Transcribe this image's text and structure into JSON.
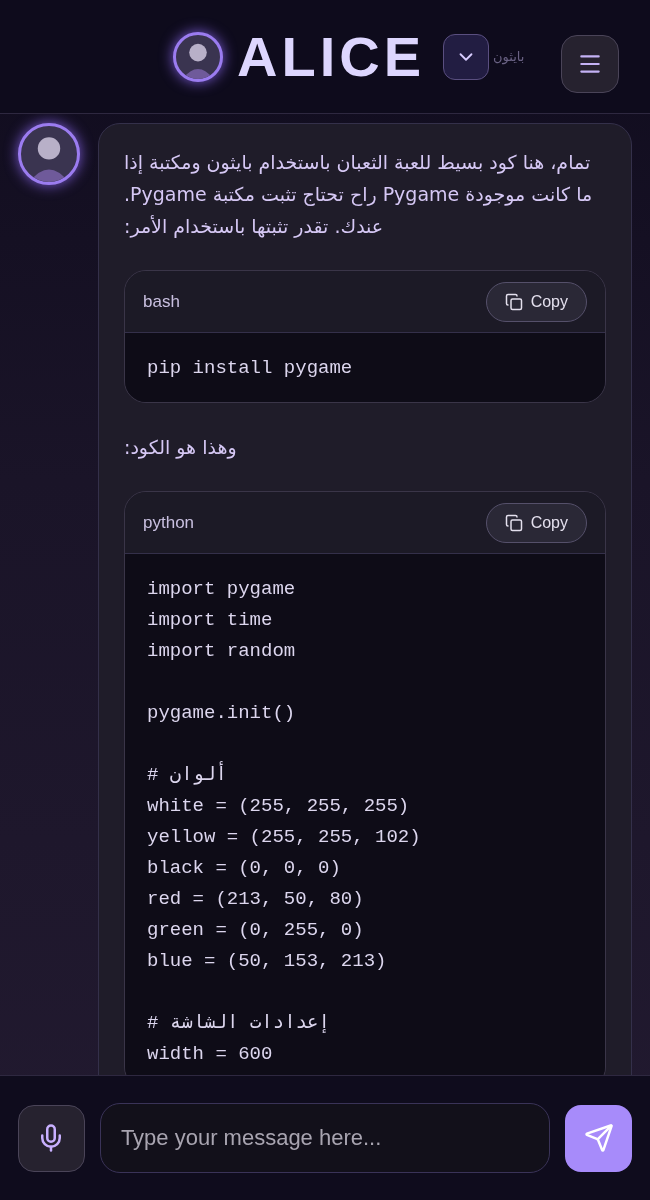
{
  "header": {
    "title": "ALICE",
    "hidden_label": "بايثون"
  },
  "messages": [
    {
      "parts": [
        {
          "kind": "text",
          "text": "تمام، هنا كود بسيط للعبة الثعبان باستخدام بايثون ومكتبة إذا ما كانت موجودة Pygame راح تحتاج تثبت مكتبة Pygame. عندك. تقدر تثبتها باستخدام الأمر:"
        },
        {
          "kind": "code",
          "language": "bash",
          "copy_label": "Copy",
          "groups": [
            [
              "pip install pygame"
            ]
          ]
        },
        {
          "kind": "text",
          "text": "وهذا هو الكود:"
        },
        {
          "kind": "code",
          "language": "python",
          "copy_label": "Copy",
          "groups": [
            [
              "import pygame",
              "import time",
              "import random"
            ],
            [
              "pygame.init()"
            ],
            [
              "# ألوان",
              "white = (255, 255, 255)",
              "yellow = (255, 255, 102)",
              "black = (0, 0, 0)",
              "red = (213, 50, 80)",
              "green = (0, 255, 0)",
              "blue = (50, 153, 213)"
            ],
            [
              "# إعدادات الشاشة",
              "width = 600"
            ]
          ]
        }
      ]
    }
  ],
  "composer": {
    "placeholder": "Type your message here..."
  }
}
